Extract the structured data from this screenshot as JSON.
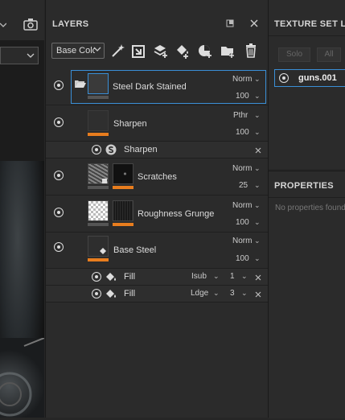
{
  "viewport": {
    "camera_icon": "camera-icon"
  },
  "layers_panel": {
    "title": "LAYERS",
    "channel_select": "Base Color",
    "tools": [
      "add-effect-icon",
      "add-mask-icon",
      "add-layer-icon",
      "add-fill-layer-icon",
      "add-generator-icon",
      "add-folder-icon",
      "delete-icon"
    ],
    "layers": [
      {
        "name": "Steel Dark Stained",
        "blend": "Norm",
        "opacity": "100",
        "type": "folder",
        "selected": true
      },
      {
        "name": "Sharpen",
        "blend": "Pthr",
        "opacity": "100",
        "type": "filter"
      },
      {
        "name": "Scratches",
        "blend": "Norm",
        "opacity": "25",
        "type": "layer"
      },
      {
        "name": "Roughness Grunge",
        "blend": "Norm",
        "opacity": "100",
        "type": "layer"
      },
      {
        "name": "Base Steel",
        "blend": "Norm",
        "opacity": "100",
        "type": "fill-layer"
      }
    ],
    "sub_effects": [
      {
        "name": "Sharpen",
        "parent": "Sharpen"
      },
      {
        "name": "Fill",
        "blend": "Isub",
        "value": "1"
      },
      {
        "name": "Fill",
        "blend": "Ldge",
        "value": "3"
      }
    ]
  },
  "texture_set_panel": {
    "title": "TEXTURE SET LIST",
    "buttons": [
      "Solo",
      "All"
    ],
    "items": [
      {
        "name": "guns.001"
      }
    ]
  },
  "properties_panel": {
    "title": "PROPERTIES",
    "empty_text": "No properties found"
  },
  "colors": {
    "accent_orange": "#e87d1e",
    "selection_blue": "#3a8fd6",
    "panel_bg": "#2b2b2b"
  }
}
